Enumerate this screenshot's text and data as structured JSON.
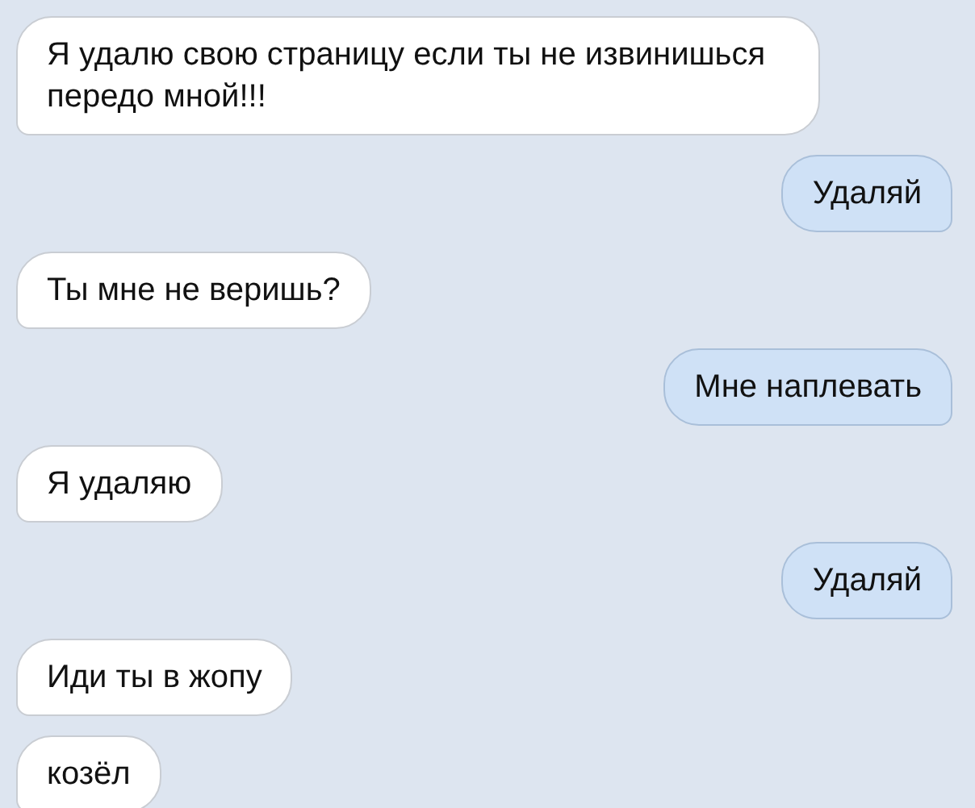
{
  "messages": [
    {
      "kind": "incoming",
      "text": "Я удалю свою страницу если ты не извинишься передо мной!!!"
    },
    {
      "kind": "outgoing",
      "text": "Удаляй"
    },
    {
      "kind": "incoming",
      "text": "Ты мне не веришь?"
    },
    {
      "kind": "outgoing",
      "text": "Мне наплевать"
    },
    {
      "kind": "incoming",
      "text": "Я удаляю"
    },
    {
      "kind": "outgoing",
      "text": "Удаляй"
    },
    {
      "kind": "incoming",
      "text": "Иди ты в жопу"
    },
    {
      "kind": "incoming",
      "text": "козёл"
    }
  ]
}
